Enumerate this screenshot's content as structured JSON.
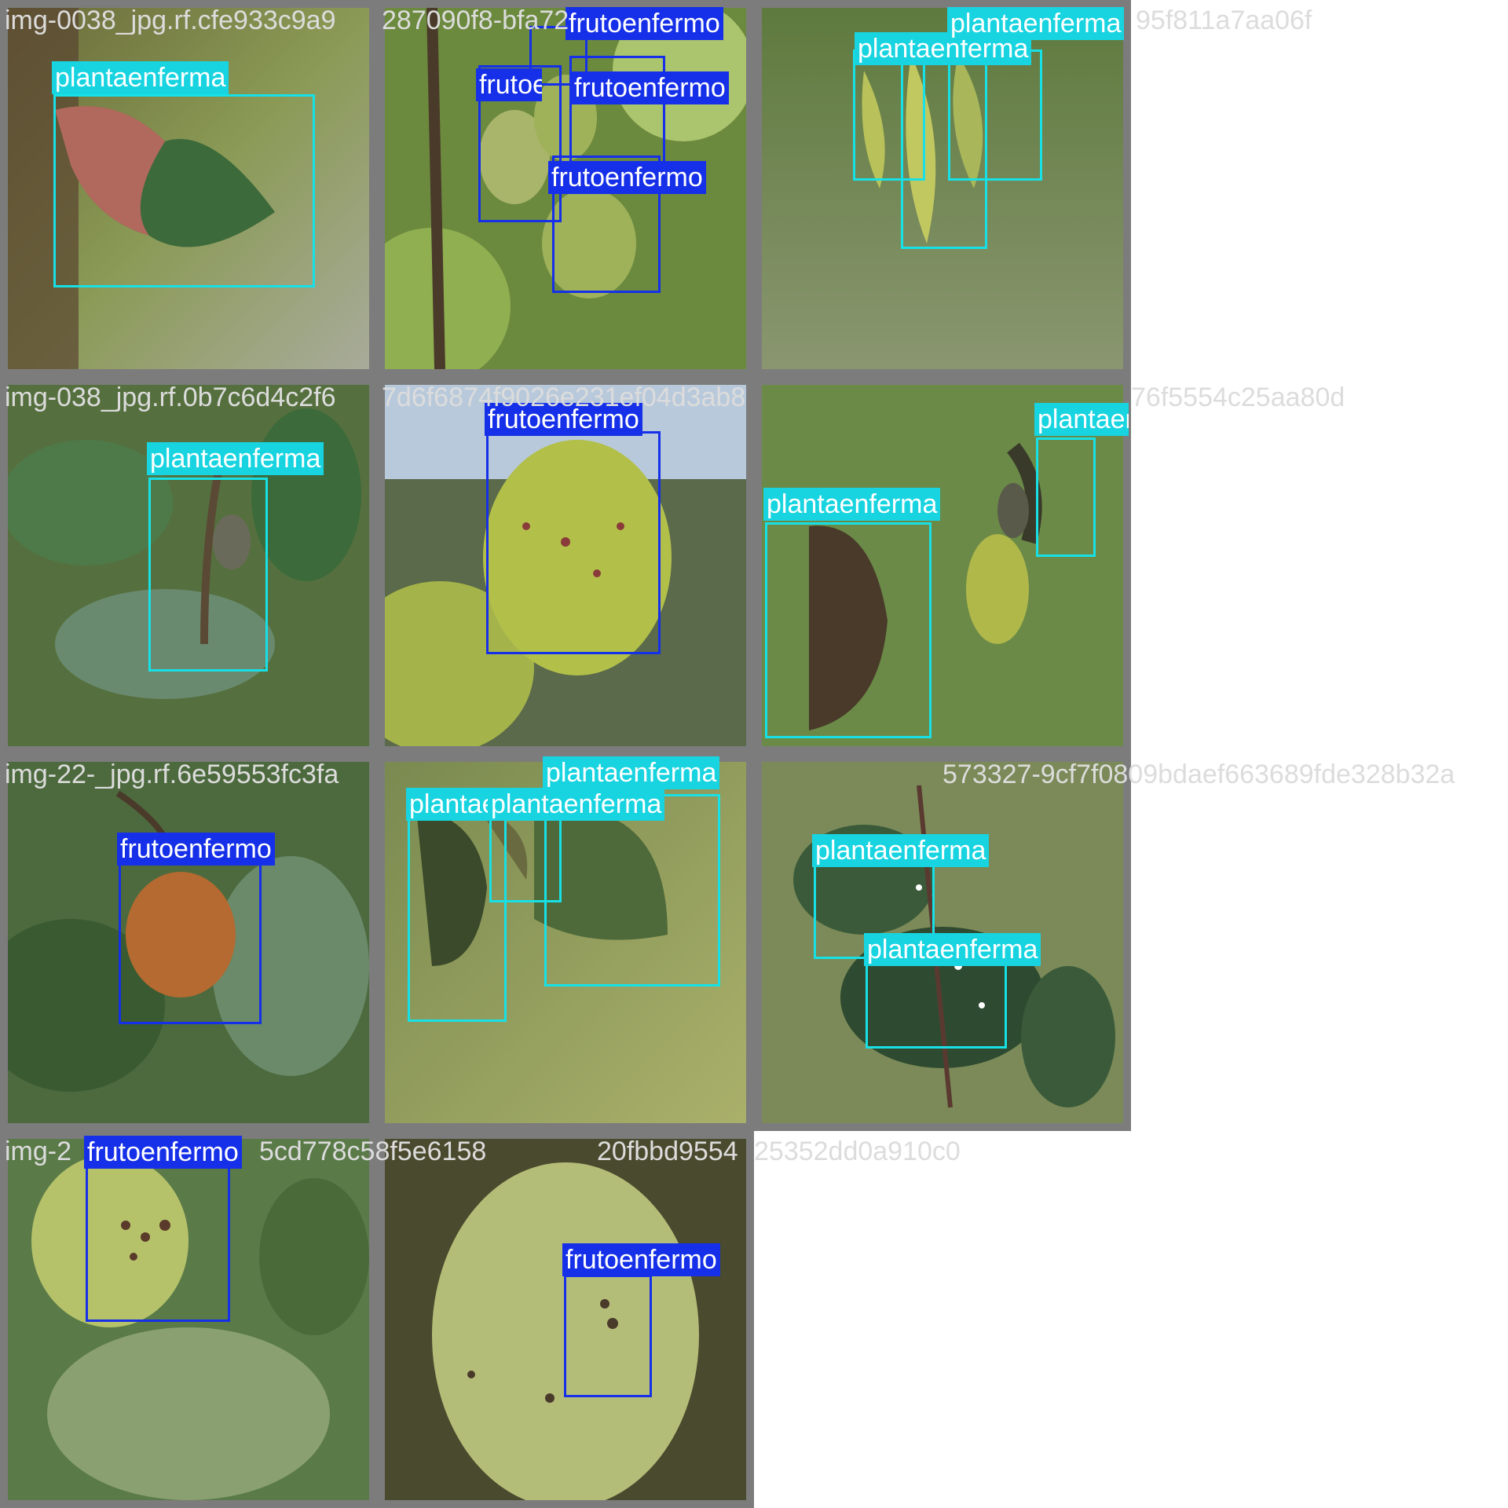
{
  "classes": {
    "plant": "plantaenferma",
    "fruit": "frutoenfermo"
  },
  "colors": {
    "plant": "#17d4e0",
    "fruit": "#1530e8",
    "tile_border": "#7c7c7c",
    "filename_text": "#dcdcdc"
  },
  "tiles": [
    {
      "filename": "img-0038_jpg.rf.cfe933c9a9"
    },
    {
      "filename": "287090f8-bfa72"
    },
    {
      "filename": "95f811a7aa06f"
    },
    {
      "filename": "img-038_jpg.rf.0b7c6d4c2f6"
    },
    {
      "filename": "7d6f6874f9026e231ef04d3ab8"
    },
    {
      "filename": "76f5554c25aa80d"
    },
    {
      "filename": "img-22-_jpg.rf.6e59553fc3fa"
    },
    {
      "filename": "573327-9cf7f0809bdaef663689fde328b32a"
    },
    {
      "filename": "img-2"
    },
    {
      "filename": "5cd778c58f5e6158"
    },
    {
      "filename": "20fbbd9554"
    },
    {
      "filename": "25352dd0a910c0"
    }
  ]
}
